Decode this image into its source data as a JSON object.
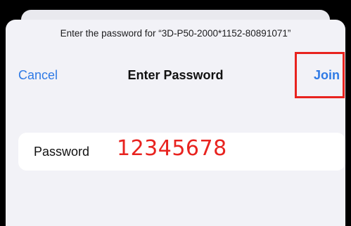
{
  "dialog": {
    "prompt": "Enter the password for “3D-P50-2000*1152-80891071”",
    "cancel_label": "Cancel",
    "title": "Enter Password",
    "join_label": "Join"
  },
  "password_field": {
    "label": "Password",
    "value": "12345678"
  },
  "colors": {
    "accent": "#2f7ae5",
    "annotation": "#e8231f",
    "sheet_background": "#f2f2f7",
    "field_background": "#ffffff"
  }
}
